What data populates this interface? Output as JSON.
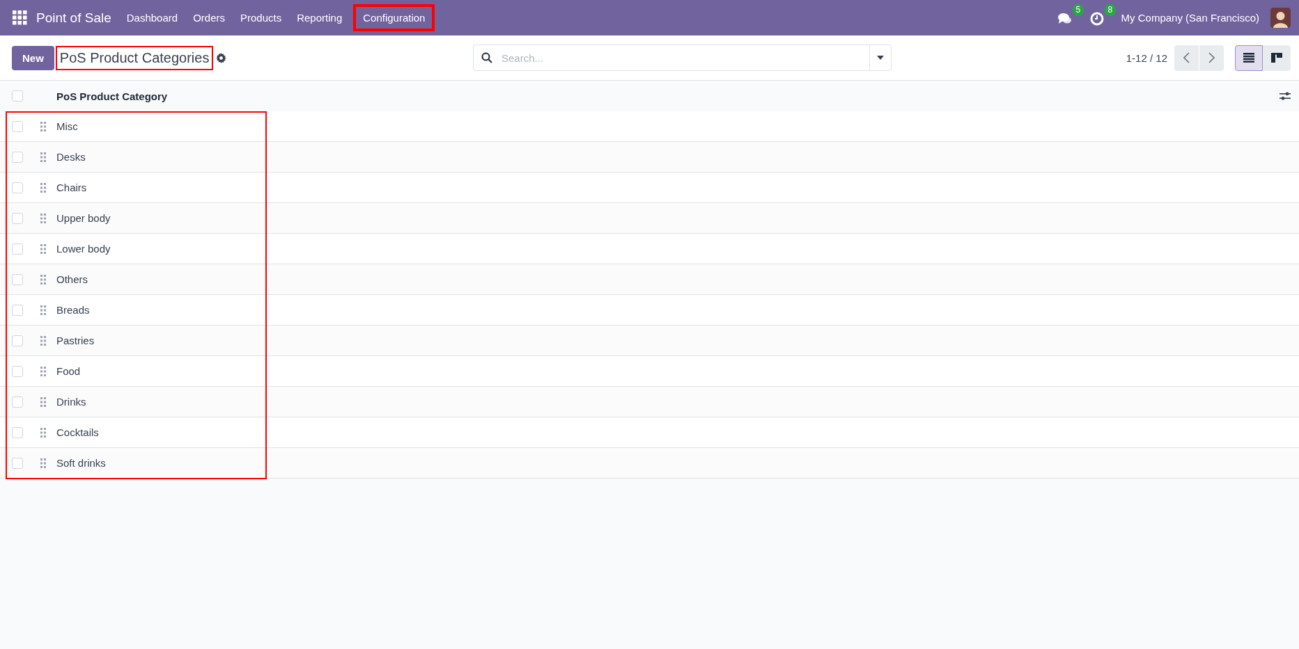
{
  "navbar": {
    "app_title": "Point of Sale",
    "menu": [
      {
        "label": "Dashboard",
        "highlighted": false
      },
      {
        "label": "Orders",
        "highlighted": false
      },
      {
        "label": "Products",
        "highlighted": false
      },
      {
        "label": "Reporting",
        "highlighted": false
      },
      {
        "label": "Configuration",
        "highlighted": true
      }
    ],
    "messages_badge": "5",
    "activities_badge": "8",
    "company": "My Company (San Francisco)"
  },
  "control_panel": {
    "new_button": "New",
    "title": "PoS Product Categories",
    "title_highlighted": true,
    "search": {
      "placeholder": "Search..."
    },
    "pager": "1-12 / 12",
    "views": [
      {
        "kind": "list",
        "selected": true
      },
      {
        "kind": "kanban",
        "selected": false
      }
    ]
  },
  "table": {
    "columns": [
      "PoS Product Category"
    ],
    "select_all_checked": false,
    "rows_highlighted": true,
    "rows": [
      {
        "name": "Misc",
        "checked": false
      },
      {
        "name": "Desks",
        "checked": false
      },
      {
        "name": "Chairs",
        "checked": false
      },
      {
        "name": "Upper body",
        "checked": false
      },
      {
        "name": "Lower body",
        "checked": false
      },
      {
        "name": "Others",
        "checked": false
      },
      {
        "name": "Breads",
        "checked": false
      },
      {
        "name": "Pastries",
        "checked": false
      },
      {
        "name": "Food",
        "checked": false
      },
      {
        "name": "Drinks",
        "checked": false
      },
      {
        "name": "Cocktails",
        "checked": false
      },
      {
        "name": "Soft drinks",
        "checked": false
      }
    ]
  }
}
